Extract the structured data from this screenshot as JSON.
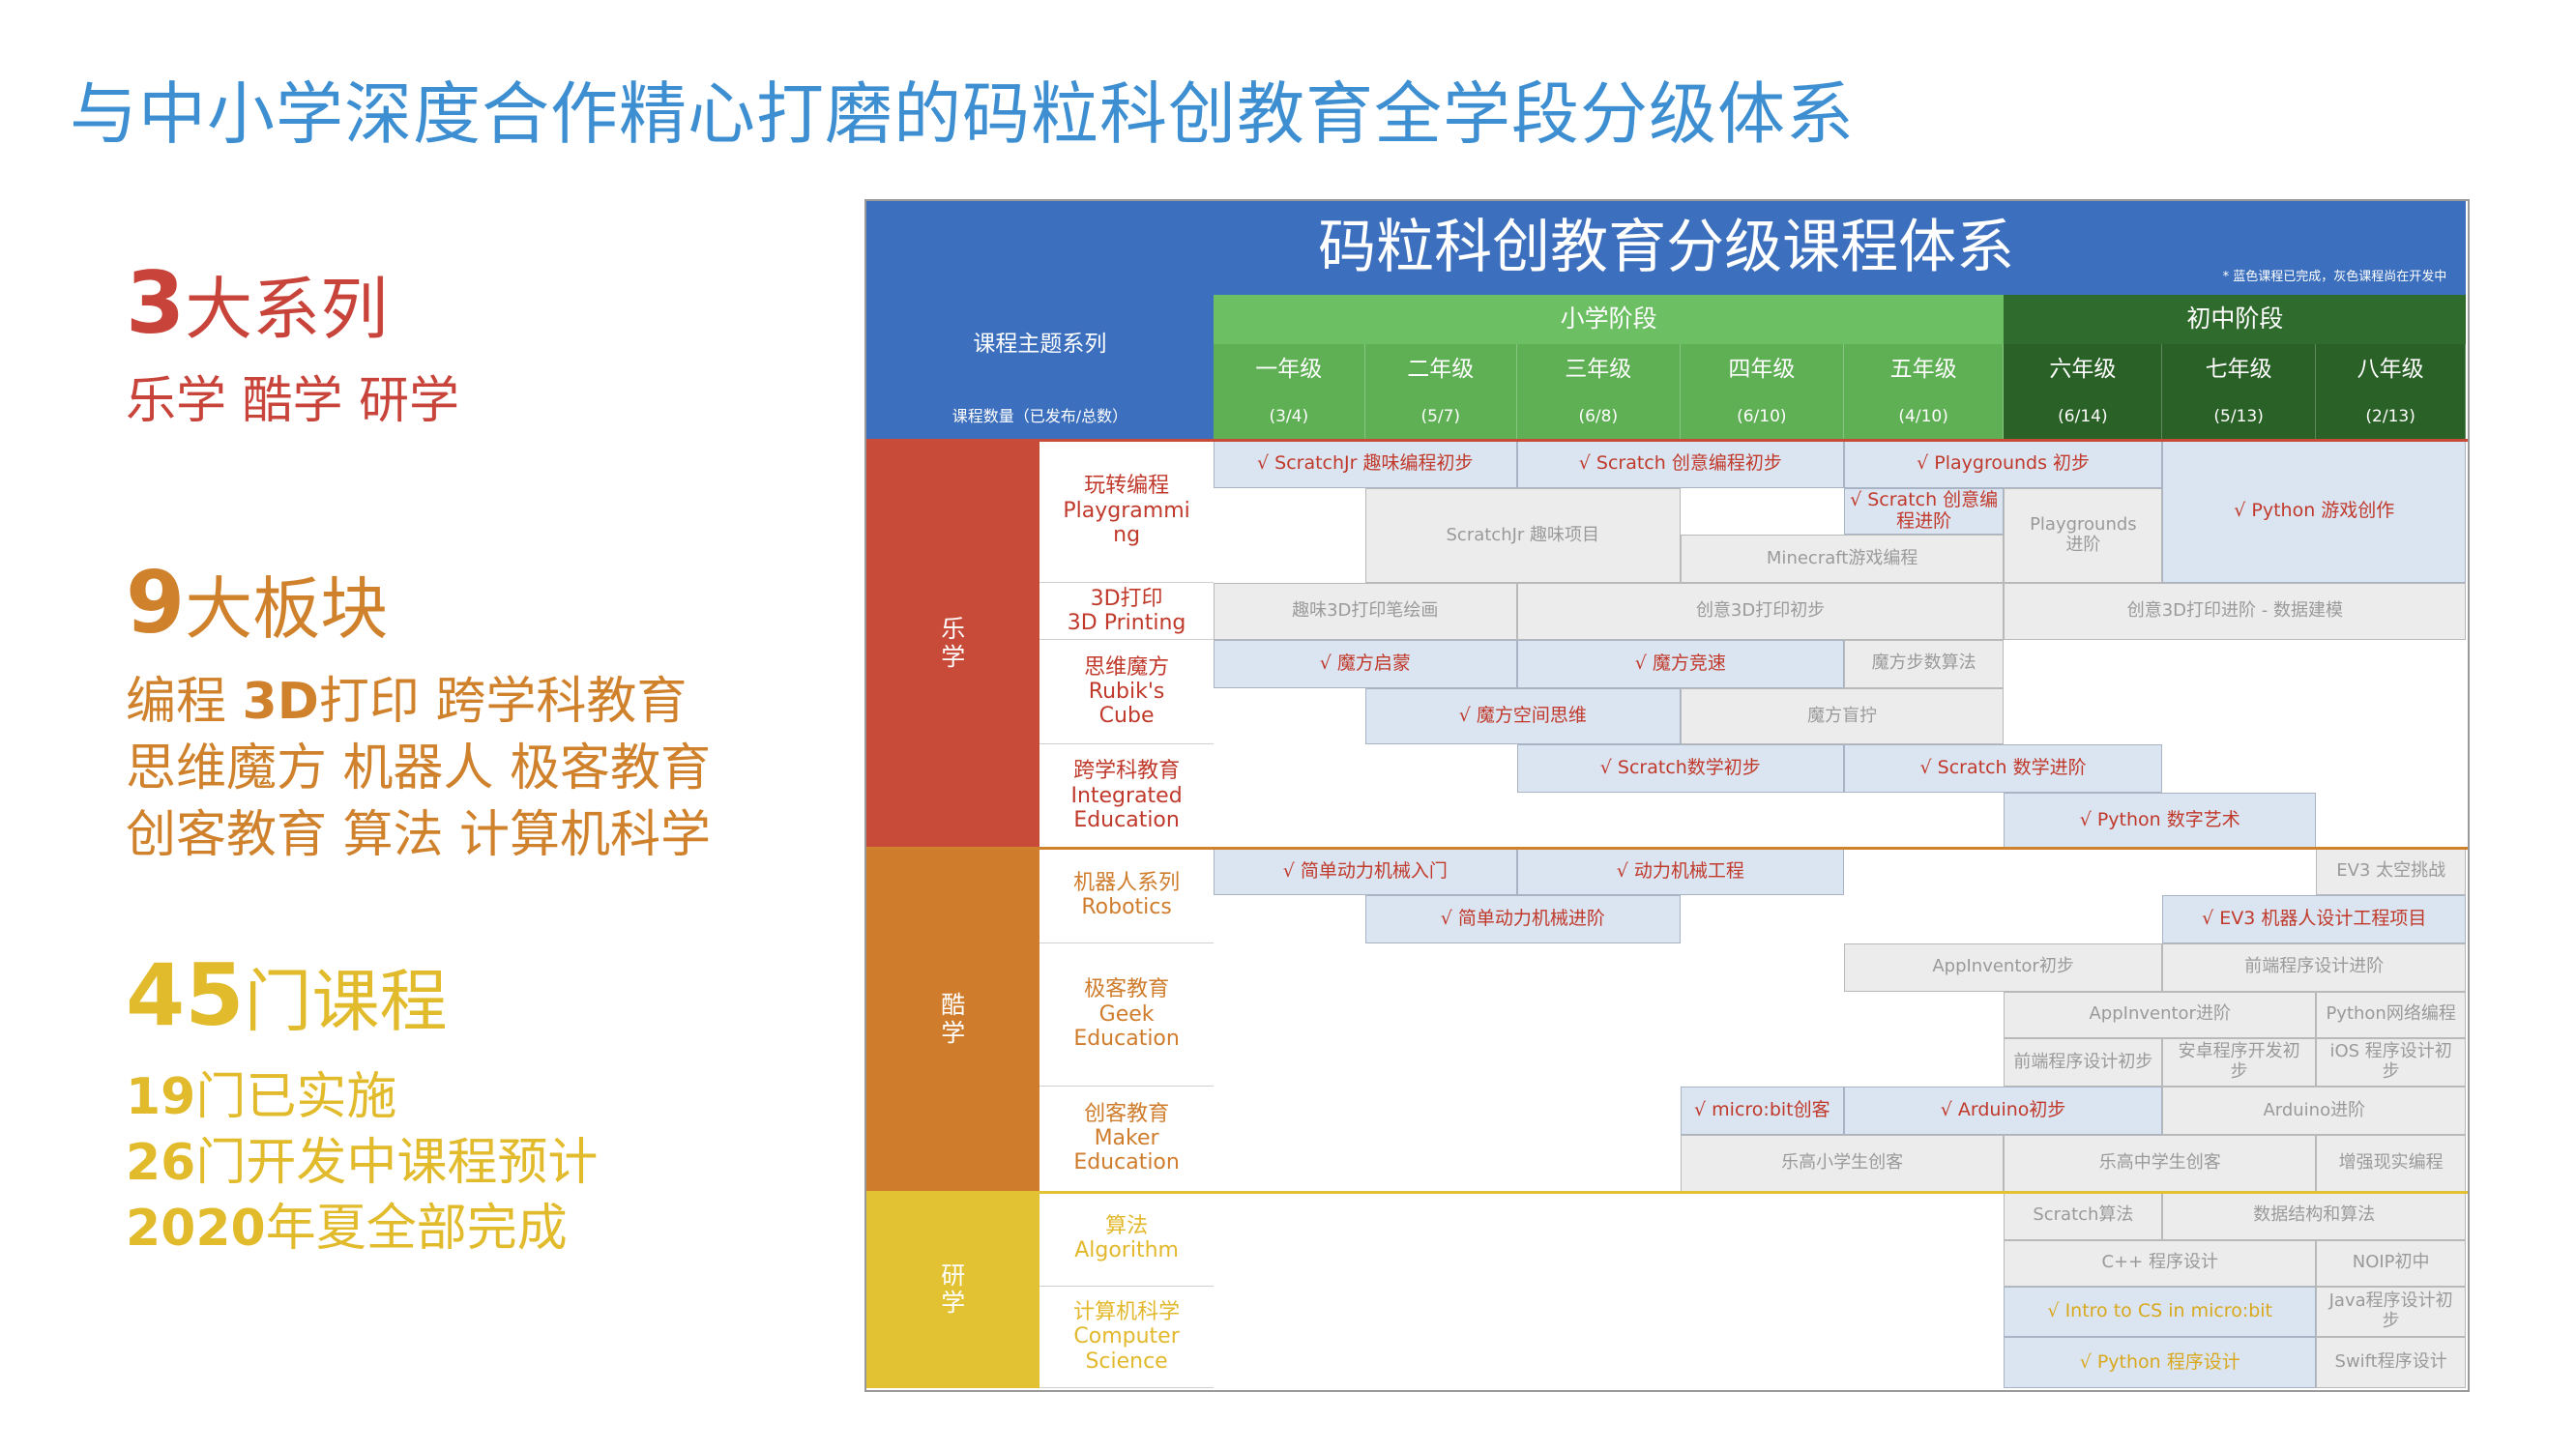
{
  "page_title": "与中小学深度合作精心打磨的码粒科创教育全学段分级体系",
  "left": {
    "series": {
      "num": "3",
      "label": "大系列",
      "items": "乐学 酷学 研学"
    },
    "blocks": {
      "num": "9",
      "label": "大板块",
      "line1": "编程 ",
      "line1b": "3D",
      "line1c": "打印 跨学科教育",
      "line2": "思维魔方 机器人 极客教育",
      "line3": "创客教育 算法 计算机科学"
    },
    "courses": {
      "num": "45",
      "label": "门课程",
      "done_num": "19",
      "done_label": "门已实施",
      "dev_num": "26",
      "dev_label": "门开发中课程预计",
      "year_num": "2020",
      "year_label": "年夏全部完成"
    }
  },
  "table": {
    "title": "码粒科创教育分级课程体系",
    "note": "* 蓝色课程已完成，灰色课程尚在开发中",
    "topic_header": "课程主题系列",
    "count_header": "课程数量（已发布/总数）",
    "stage_primary": "小学阶段",
    "stage_middle": "初中阶段",
    "grades": [
      "一年级",
      "二年级",
      "三年级",
      "四年级",
      "五年级",
      "六年级",
      "七年级",
      "八年级"
    ],
    "counts": [
      "(3/4)",
      "(5/7)",
      "(6/8)",
      "(6/10)",
      "(4/10)",
      "(6/14)",
      "(5/13)",
      "(2/13)"
    ],
    "categories": [
      {
        "name": "乐\n学",
        "color": "#c84b3a"
      },
      {
        "name": "酷\n学",
        "color": "#cf7d2d"
      },
      {
        "name": "研\n学",
        "color": "#e2c132"
      }
    ],
    "subjects": [
      {
        "label": "玩转编程\nPlaygrammi\nng",
        "color": "#c0392b"
      },
      {
        "label": "3D打印\n3D Printing",
        "color": "#c0392b"
      },
      {
        "label": "思维魔方\nRubik's\nCube",
        "color": "#c0392b"
      },
      {
        "label": "跨学科教育\nIntegrated\nEducation",
        "color": "#c0392b"
      },
      {
        "label": "机器人系列\nRobotics",
        "color": "#cf7d2d"
      },
      {
        "label": "极客教育\nGeek\nEducation",
        "color": "#cf7d2d"
      },
      {
        "label": "创客教育\nMaker\nEducation",
        "color": "#cf7d2d"
      },
      {
        "label": "算法\nAlgorithm",
        "color": "#e2b82c"
      },
      {
        "label": "计算机科学\nComputer\nScience",
        "color": "#e2b82c"
      }
    ],
    "cells": [
      {
        "text": "√ ScratchJr 趣味编程初步",
        "t": "b"
      },
      {
        "text": "√ Scratch 创意编程初步",
        "t": "b"
      },
      {
        "text": "√ Playgrounds 初步",
        "t": "b"
      },
      {
        "text": "√ Python 游戏创作",
        "t": "b"
      },
      {
        "text": "√ Scratch 创意编程进阶",
        "t": "b"
      },
      {
        "text": "ScratchJr 趣味项目",
        "t": "g"
      },
      {
        "text": "Playgrounds\n进阶",
        "t": "g"
      },
      {
        "text": "Minecraft游戏编程",
        "t": "g"
      },
      {
        "text": "趣味3D打印笔绘画",
        "t": "g"
      },
      {
        "text": "创意3D打印初步",
        "t": "g"
      },
      {
        "text": "创意3D打印进阶 - 数据建模",
        "t": "g"
      },
      {
        "text": "√ 魔方启蒙",
        "t": "b"
      },
      {
        "text": "√ 魔方竞速",
        "t": "b"
      },
      {
        "text": "魔方步数算法",
        "t": "g"
      },
      {
        "text": "√ 魔方空间思维",
        "t": "b"
      },
      {
        "text": "魔方盲拧",
        "t": "g"
      },
      {
        "text": "√ Scratch数学初步",
        "t": "b"
      },
      {
        "text": "√ Scratch 数学进阶",
        "t": "b"
      },
      {
        "text": "√ Python 数字艺术",
        "t": "b"
      },
      {
        "text": "√ 简单动力机械入门",
        "t": "b"
      },
      {
        "text": "√ 动力机械工程",
        "t": "b"
      },
      {
        "text": "EV3 太空挑战",
        "t": "g"
      },
      {
        "text": "√ 简单动力机械进阶",
        "t": "b"
      },
      {
        "text": "√ EV3 机器人设计工程项目",
        "t": "b"
      },
      {
        "text": "AppInventor初步",
        "t": "g"
      },
      {
        "text": "前端程序设计进阶",
        "t": "g"
      },
      {
        "text": "AppInventor进阶",
        "t": "g"
      },
      {
        "text": "Python网络编程",
        "t": "g"
      },
      {
        "text": "前端程序设计初步",
        "t": "g"
      },
      {
        "text": "安卓程序开发初\n步",
        "t": "g"
      },
      {
        "text": "iOS 程序设计初\n步",
        "t": "g"
      },
      {
        "text": "√ micro:bit创客",
        "t": "b"
      },
      {
        "text": "√ Arduino初步",
        "t": "b"
      },
      {
        "text": "Arduino进阶",
        "t": "g"
      },
      {
        "text": "乐高小学生创客",
        "t": "g"
      },
      {
        "text": "乐高中学生创客",
        "t": "g"
      },
      {
        "text": "增强现实编程",
        "t": "g"
      },
      {
        "text": "Scratch算法",
        "t": "g"
      },
      {
        "text": "数据结构和算法",
        "t": "g"
      },
      {
        "text": "C++ 程序设计",
        "t": "g"
      },
      {
        "text": "NOIP初中",
        "t": "g"
      },
      {
        "text": "√ Intro to CS in micro:bit",
        "t": "y"
      },
      {
        "text": "Java程序设计初\n步",
        "t": "g"
      },
      {
        "text": "√ Python 程序设计",
        "t": "y"
      },
      {
        "text": "Swift程序设计",
        "t": "g"
      }
    ]
  }
}
